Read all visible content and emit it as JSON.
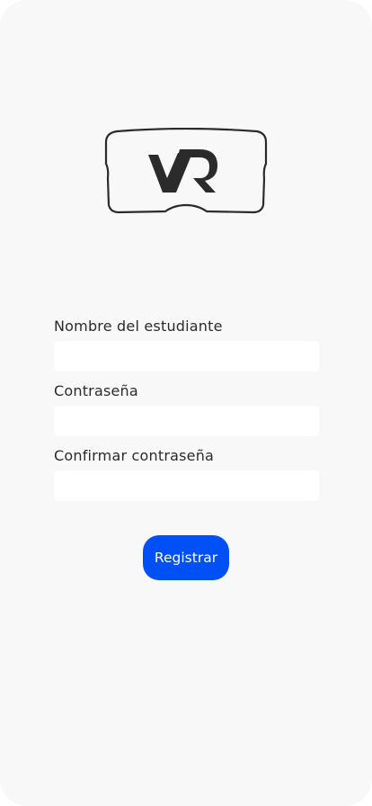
{
  "logo": {
    "icon": "vr-headset-logo-icon",
    "text": "VR"
  },
  "form": {
    "student_name": {
      "label": "Nombre del estudiante",
      "value": "",
      "placeholder": ""
    },
    "password": {
      "label": "Contraseña",
      "value": "",
      "placeholder": ""
    },
    "confirm_password": {
      "label": "Confirmar contraseña",
      "value": "",
      "placeholder": ""
    },
    "submit_label": "Registrar"
  },
  "colors": {
    "background": "#f8f8f8",
    "input_background": "#ffffff",
    "accent": "#0050f5",
    "text": "#2b2b2b"
  }
}
